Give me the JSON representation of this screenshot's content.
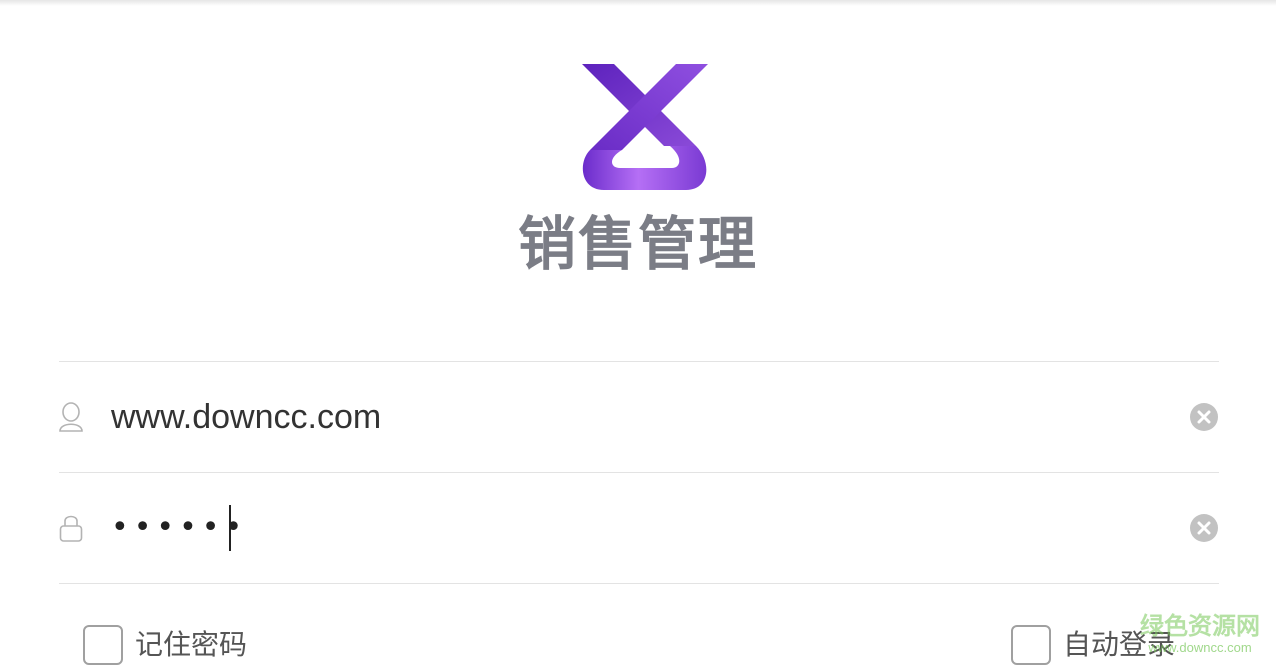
{
  "app": {
    "title": "销售管理",
    "logo_icon": "sales-management-logo",
    "brand_colors": [
      "#6a2fc7",
      "#8b4de0",
      "#b06bf0"
    ]
  },
  "login_form": {
    "username": {
      "icon": "user-icon",
      "value": "www.downcc.com",
      "clear_icon": "clear-icon"
    },
    "password": {
      "icon": "lock-icon",
      "masked_value": "••••••",
      "clear_icon": "clear-icon"
    },
    "remember_password": {
      "label": "记住密码",
      "checked": false
    },
    "auto_login": {
      "label": "自动登录",
      "checked": false
    }
  },
  "watermark": {
    "cn": "绿色资源网",
    "en": "www.downcc.com"
  }
}
